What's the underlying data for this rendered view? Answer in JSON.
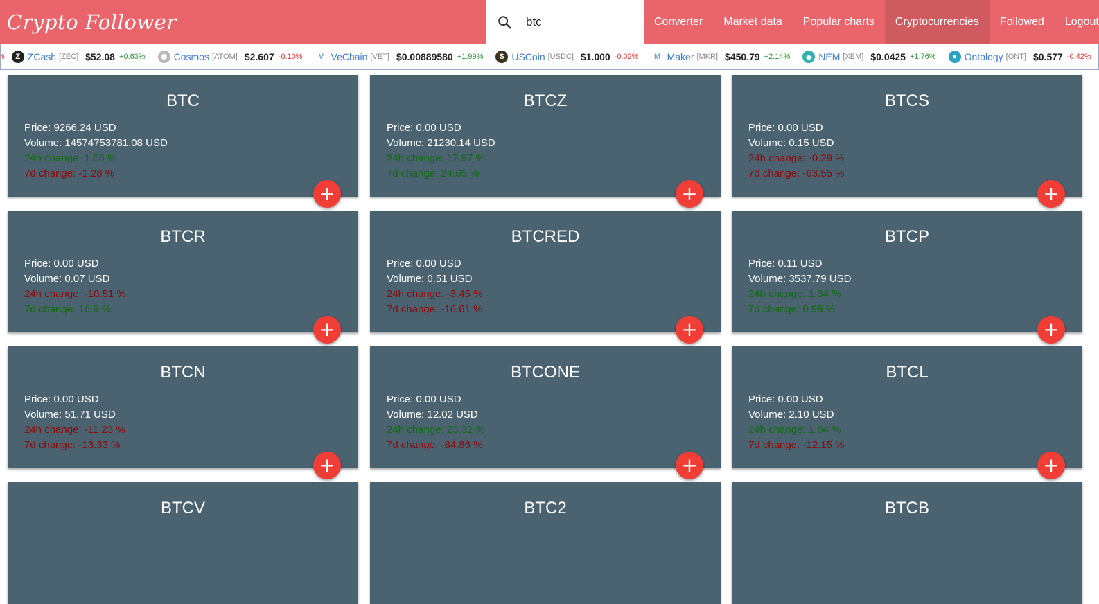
{
  "brand": "Crypto Follower",
  "search": {
    "value": "btc",
    "icon": "search-icon"
  },
  "nav": [
    {
      "label": "Converter",
      "active": false
    },
    {
      "label": "Market data",
      "active": false
    },
    {
      "label": "Popular charts",
      "active": false
    },
    {
      "label": "Cryptocurrencies",
      "active": true
    },
    {
      "label": "Followed",
      "active": false
    },
    {
      "label": "Logout",
      "active": false
    }
  ],
  "ticker": {
    "fragment": "%",
    "items": [
      {
        "name": "ZCash",
        "symbol": "[ZEC]",
        "price": "$52.08",
        "change": "+0.63%",
        "dir": "pos",
        "icon_color": "#222222",
        "icon_char": "Z"
      },
      {
        "name": "Cosmos",
        "symbol": "[ATOM]",
        "price": "$2.607",
        "change": "-0.10%",
        "dir": "neg",
        "icon_color": "#b9b9b9",
        "icon_char": "✺"
      },
      {
        "name": "VeChain",
        "symbol": "[VET]",
        "price": "$0.00889580",
        "change": "+1.99%",
        "dir": "pos",
        "icon_color": "#ffffff",
        "icon_char": "V"
      },
      {
        "name": "USCoin",
        "symbol": "[USDC]",
        "price": "$1.000",
        "change": "-0.02%",
        "dir": "neg",
        "icon_color": "#3b3320",
        "icon_char": "$"
      },
      {
        "name": "Maker",
        "symbol": "[MKR]",
        "price": "$450.79",
        "change": "+2.14%",
        "dir": "pos",
        "icon_color": "#ffffff",
        "icon_char": "M"
      },
      {
        "name": "NEM",
        "symbol": "[XEM]",
        "price": "$0.0425",
        "change": "+1.76%",
        "dir": "pos",
        "icon_color": "#2fb3b0",
        "icon_char": "◆"
      },
      {
        "name": "Ontology",
        "symbol": "[ONT]",
        "price": "$0.577",
        "change": "-0.42%",
        "dir": "neg",
        "icon_color": "#2aa3c9",
        "icon_char": "●"
      }
    ]
  },
  "cards": [
    {
      "title": "BTC",
      "price": "Price: 9266.24 USD",
      "volume": "Volume: 14574753781.08 USD",
      "change24": "24h change: 1.06 %",
      "dir24": "green",
      "change7": "7d change: -1.28 %",
      "dir7": "red"
    },
    {
      "title": "BTCZ",
      "price": "Price: 0.00 USD",
      "volume": "Volume: 21230.14 USD",
      "change24": "24h change: 17.97 %",
      "dir24": "green",
      "change7": "7d change: 24.65 %",
      "dir7": "green"
    },
    {
      "title": "BTCS",
      "price": "Price: 0.00 USD",
      "volume": "Volume: 0.15 USD",
      "change24": "24h change: -0.29 %",
      "dir24": "red",
      "change7": "7d change: -63.55 %",
      "dir7": "red"
    },
    {
      "title": "BTCR",
      "price": "Price: 0.00 USD",
      "volume": "Volume: 0.07 USD",
      "change24": "24h change: -10.51 %",
      "dir24": "red",
      "change7": "7d change: 16.9 %",
      "dir7": "green"
    },
    {
      "title": "BTCRED",
      "price": "Price: 0.00 USD",
      "volume": "Volume: 0.51 USD",
      "change24": "24h change: -3.45 %",
      "dir24": "red",
      "change7": "7d change: -16.61 %",
      "dir7": "red"
    },
    {
      "title": "BTCP",
      "price": "Price: 0.11 USD",
      "volume": "Volume: 3537.79 USD",
      "change24": "24h change: 1.34 %",
      "dir24": "green",
      "change7": "7d change: 0.98 %",
      "dir7": "green"
    },
    {
      "title": "BTCN",
      "price": "Price: 0.00 USD",
      "volume": "Volume: 51.71 USD",
      "change24": "24h change: -11.23 %",
      "dir24": "red",
      "change7": "7d change: -13.33 %",
      "dir7": "red"
    },
    {
      "title": "BTCONE",
      "price": "Price: 0.00 USD",
      "volume": "Volume: 12.02 USD",
      "change24": "24h change: 23.32 %",
      "dir24": "green",
      "change7": "7d change: -84.86 %",
      "dir7": "red"
    },
    {
      "title": "BTCL",
      "price": "Price: 0.00 USD",
      "volume": "Volume: 2.10 USD",
      "change24": "24h change: 1.64 %",
      "dir24": "green",
      "change7": "7d change: -12.15 %",
      "dir7": "red"
    },
    {
      "title": "BTCV"
    },
    {
      "title": "BTC2"
    },
    {
      "title": "BTCB"
    }
  ],
  "add_button_label": "+",
  "colors": {
    "header": "#e9646b",
    "card": "#4b6270",
    "add_button": "#f03e36",
    "positive": "#0e6b0e",
    "negative": "#8b0a0a"
  }
}
